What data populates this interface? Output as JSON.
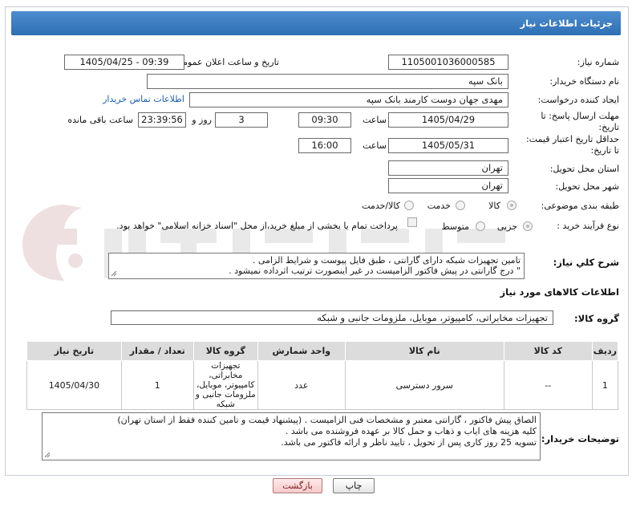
{
  "header": {
    "title": "جزئیات اطلاعات نیاز"
  },
  "fields": {
    "need_number": {
      "label": "شماره نیاز:",
      "value": "1105001036000585"
    },
    "announce": {
      "label": "تاریخ و ساعت اعلان عمومی:",
      "value": "1405/04/25 - 09:39"
    },
    "buyer_org": {
      "label": "نام دستگاه خریدار:",
      "value": "بانک سپه"
    },
    "creator": {
      "label": "ایجاد کننده درخواست:",
      "value": "مهدی جهان دوست کارمند بانک سپه",
      "contact_link": "اطلاعات تماس خریدار"
    },
    "reply_deadline": {
      "label_line1": "مهلت ارسال پاسخ: تا",
      "label_line2": "تاریخ:",
      "date": "1405/04/29",
      "time_label": "ساعت",
      "time": "09:30",
      "days": "3",
      "days_label": "روز و",
      "remaining": "23:39:56",
      "remaining_label": "ساعت باقی مانده"
    },
    "price_validity": {
      "label_line1": "حداقل تاریخ اعتبار قیمت:",
      "label_line2": "تا تاریخ:",
      "date": "1405/05/31",
      "time_label": "ساعت",
      "time": "16:00"
    },
    "delivery_province": {
      "label": "استان محل تحویل:",
      "value": "تهران"
    },
    "delivery_city": {
      "label": "شهر محل تحویل:",
      "value": "تهران"
    },
    "category": {
      "label": "طبقه بندی موضوعی:",
      "options": [
        "کالا",
        "خدمت",
        "کالا/خدمت"
      ],
      "selected": "کالا"
    },
    "purchase_type": {
      "label": "نوع فرآیند خرید :",
      "options": [
        "جزیی",
        "متوسط"
      ],
      "selected": "جزیی",
      "payment_note": "پرداخت تمام یا بخشی از مبلغ خرید،از محل \"اسناد خزانه اسلامی\" خواهد بود."
    },
    "general_description": {
      "label": "شرح کلي نیاز:",
      "lines": [
        "تامین تجهیزات شبکه دارای گارانتی ، طبق فایل پیوست و شرایط الزامی .",
        "\" درج گارانتی در پیش فاکتور الزامیست در غیر اینصورت ترتیب اثرداده نمیشود ."
      ]
    }
  },
  "goods_info": {
    "section_title": "اطلاعات کالاهای مورد نیاز",
    "group_label": "گروه کالا:",
    "group_value": "تجهیزات مخابراتی، کامپیوتر، موبایل، ملزومات جانبی و شبکه"
  },
  "table": {
    "headers": [
      "ردیف",
      "کد کالا",
      "نام کالا",
      "واحد شمارش",
      "گروه کالا",
      "تعداد / مقدار",
      "تاریخ نیاز"
    ],
    "rows": [
      {
        "row": "1",
        "code": "--",
        "name": "سرور دسترسی",
        "unit": "عدد",
        "group": "تجهیزات مخابراتی، کامپیوتر، موبایل، ملزومات جانبی و شبکه",
        "qty": "1",
        "date": "1405/04/30"
      }
    ]
  },
  "buyer_notes": {
    "label": "توضیحات خریدار:",
    "lines": [
      "الصاق پیش فاکتور ، گارانتی معتبر و مشخصات فنی الزامیست . (پیشنهاد قیمت و تامین کننده فقط از استان تهران)",
      "کلیه هزینه های ایاب و ذهاب و حمل کالا بر عهده فروشنده می باشد .",
      "تسویه 25 روز کاری پس از تحویل ، تایید ناظر و ارائه فاکتور می باشد."
    ]
  },
  "buttons": {
    "print": "چاپ",
    "back": "بازگشت"
  },
  "colors": {
    "header_bg": "#2f6fb3",
    "link": "#1b5fb0",
    "back_button": "#f6c9c9"
  },
  "icons": {
    "watermark": "aria-tender-watermark-icon",
    "resize": "textarea-resize-grip-icon"
  }
}
